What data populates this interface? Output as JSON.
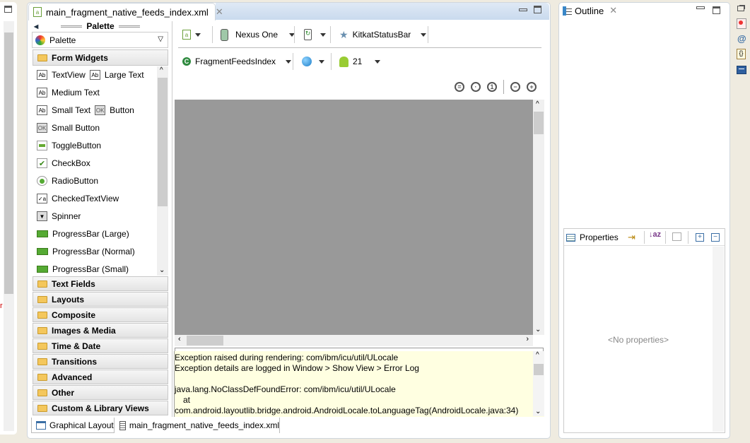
{
  "editor": {
    "tab_title": "main_fragment_native_feeds_index.xml",
    "palette_header": "Palette",
    "palette_dropdown": "Palette",
    "form_widgets_header": "Form Widgets",
    "form_widgets": [
      [
        "TextView",
        "Large Text"
      ],
      [
        "Medium Text"
      ],
      [
        "Small Text",
        "Button"
      ],
      [
        "Small Button"
      ],
      [
        "ToggleButton"
      ],
      [
        "CheckBox"
      ],
      [
        "RadioButton"
      ],
      [
        "CheckedTextView"
      ],
      [
        "Spinner"
      ],
      [
        "ProgressBar (Large)"
      ],
      [
        "ProgressBar (Normal)"
      ],
      [
        "ProgressBar (Small)"
      ]
    ],
    "categories": [
      "Text Fields",
      "Layouts",
      "Composite",
      "Images & Media",
      "Time & Date",
      "Transitions",
      "Advanced",
      "Other",
      "Custom & Library Views"
    ],
    "toolbar": {
      "device": "Nexus One",
      "theme": "KitkatStatusBar",
      "activity": "FragmentFeedsIndex",
      "api_level": "21"
    },
    "error_lines": [
      "Exception raised during rendering: com/ibm/icu/util/ULocale",
      "Exception details are logged in Window > Show View > Error Log",
      "",
      "java.lang.NoClassDefFoundError: com/ibm/icu/util/ULocale",
      "    at",
      "com.android.layoutlib.bridge.android.AndroidLocale.toLanguageTag(AndroidLocale.java:34)"
    ],
    "bottom_tabs": [
      "Graphical Layout",
      "main_fragment_native_feeds_index.xml"
    ]
  },
  "outline": {
    "title": "Outline",
    "properties_title": "Properties",
    "no_properties": "<No properties>"
  },
  "colors": {
    "error_bg": "#ffffe1",
    "canvas": "#999999",
    "accent": "#3a6ea5"
  }
}
